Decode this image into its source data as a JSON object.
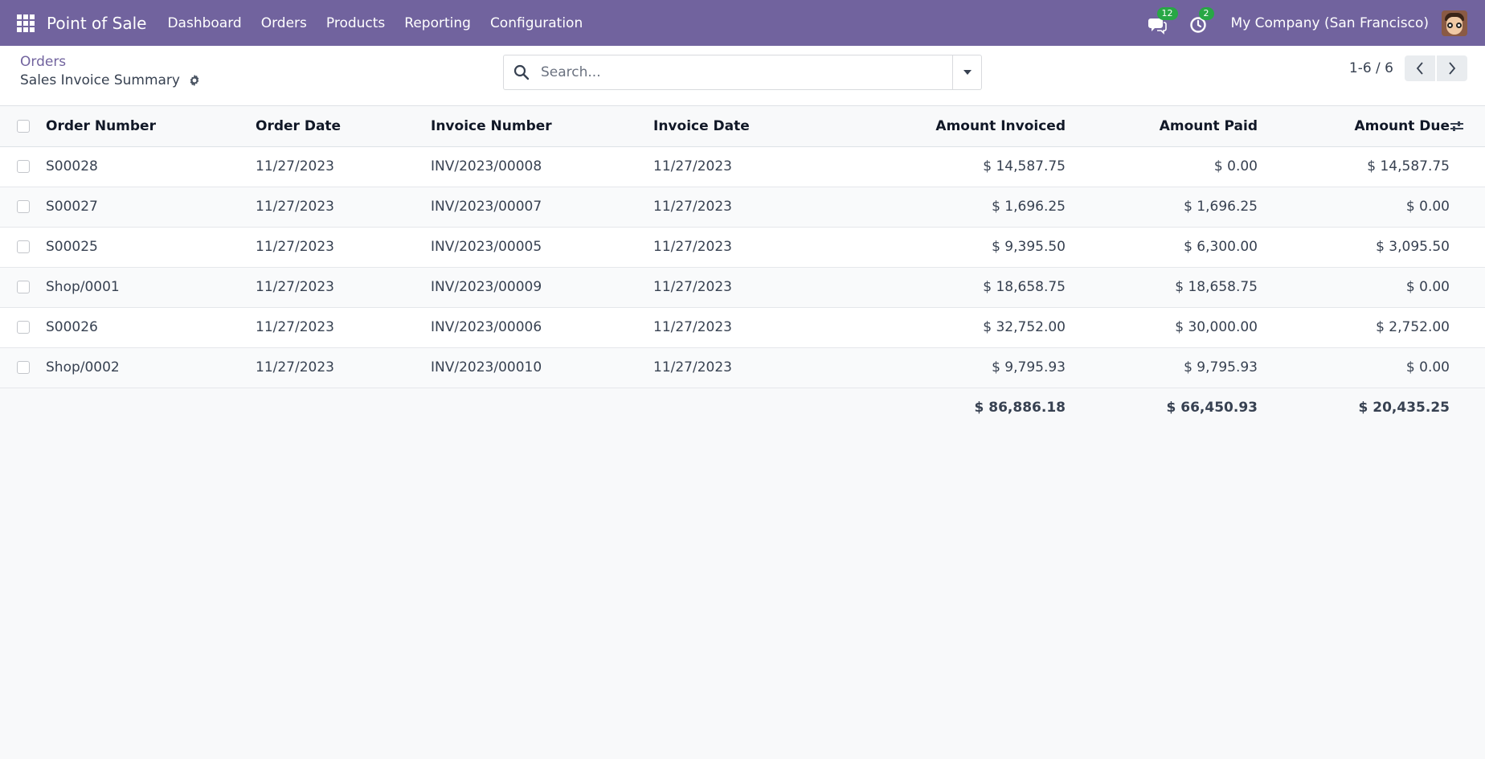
{
  "navbar": {
    "app_name": "Point of Sale",
    "menu": [
      "Dashboard",
      "Orders",
      "Products",
      "Reporting",
      "Configuration"
    ],
    "messages_count": "12",
    "activities_count": "2",
    "company": "My Company (San Francisco)",
    "bg_color": "#71639e"
  },
  "control_panel": {
    "breadcrumb": "Orders",
    "title": "Sales Invoice Summary",
    "search_placeholder": "Search...",
    "pager": "1-6 / 6"
  },
  "table": {
    "columns": [
      "Order Number",
      "Order Date",
      "Invoice Number",
      "Invoice Date",
      "Amount Invoiced",
      "Amount Paid",
      "Amount Due"
    ],
    "rows": [
      {
        "order": "S00028",
        "order_date": "11/27/2023",
        "invoice": "INV/2023/00008",
        "invoice_date": "11/27/2023",
        "invoiced": "$ 14,587.75",
        "paid": "$ 0.00",
        "due": "$ 14,587.75"
      },
      {
        "order": "S00027",
        "order_date": "11/27/2023",
        "invoice": "INV/2023/00007",
        "invoice_date": "11/27/2023",
        "invoiced": "$ 1,696.25",
        "paid": "$ 1,696.25",
        "due": "$ 0.00"
      },
      {
        "order": "S00025",
        "order_date": "11/27/2023",
        "invoice": "INV/2023/00005",
        "invoice_date": "11/27/2023",
        "invoiced": "$ 9,395.50",
        "paid": "$ 6,300.00",
        "due": "$ 3,095.50"
      },
      {
        "order": "Shop/0001",
        "order_date": "11/27/2023",
        "invoice": "INV/2023/00009",
        "invoice_date": "11/27/2023",
        "invoiced": "$ 18,658.75",
        "paid": "$ 18,658.75",
        "due": "$ 0.00"
      },
      {
        "order": "S00026",
        "order_date": "11/27/2023",
        "invoice": "INV/2023/00006",
        "invoice_date": "11/27/2023",
        "invoiced": "$ 32,752.00",
        "paid": "$ 30,000.00",
        "due": "$ 2,752.00"
      },
      {
        "order": "Shop/0002",
        "order_date": "11/27/2023",
        "invoice": "INV/2023/00010",
        "invoice_date": "11/27/2023",
        "invoiced": "$ 9,795.93",
        "paid": "$ 9,795.93",
        "due": "$ 0.00"
      }
    ],
    "totals": {
      "invoiced": "$ 86,886.18",
      "paid": "$ 66,450.93",
      "due": "$ 20,435.25"
    }
  }
}
